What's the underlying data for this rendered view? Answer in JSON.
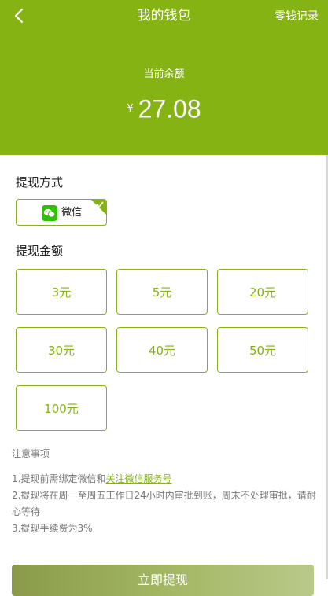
{
  "header": {
    "title": "我的钱包",
    "records_link": "零钱记录",
    "balance_label": "当前余额",
    "currency": "¥",
    "balance": "27.08"
  },
  "withdraw_method": {
    "section_title": "提现方式",
    "option_label": "微信",
    "selected": true
  },
  "withdraw_amount": {
    "section_title": "提现金额",
    "options": [
      "3元",
      "5元",
      "20元",
      "30元",
      "40元",
      "50元",
      "100元"
    ]
  },
  "notes": {
    "title": "注意事项",
    "line1_prefix": "1.提现前需绑定微信和",
    "line1_link": "关注微信服务号",
    "line2": "2.提现将在周一至周五工作日24小时内审批到账，周末不处理审批，请耐心等待",
    "line3": "3.提现手续费为3%"
  },
  "submit_label": "立即提现",
  "colors": {
    "accent": "#86b314",
    "wechat": "#2dc100"
  }
}
